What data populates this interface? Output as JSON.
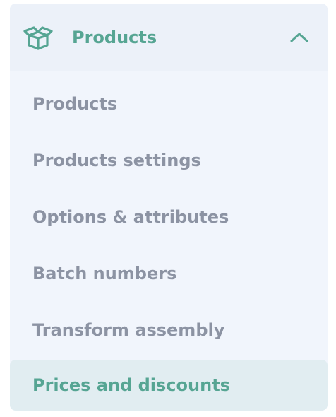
{
  "colors": {
    "accent": "#56a593",
    "text_muted": "#8c93a3",
    "panel_bg": "#f1f5fc",
    "header_bg": "#ecf1f9",
    "active_bg": "#e1edf1"
  },
  "group": {
    "icon": "package-box-icon",
    "label": "Products",
    "expanded": true,
    "toggle_icon": "chevron-up-icon"
  },
  "items": [
    {
      "label": "Products",
      "active": false
    },
    {
      "label": "Products settings",
      "active": false
    },
    {
      "label": "Options & attributes",
      "active": false
    },
    {
      "label": "Batch numbers",
      "active": false
    },
    {
      "label": "Transform assembly",
      "active": false
    },
    {
      "label": "Prices and discounts",
      "active": true
    }
  ]
}
